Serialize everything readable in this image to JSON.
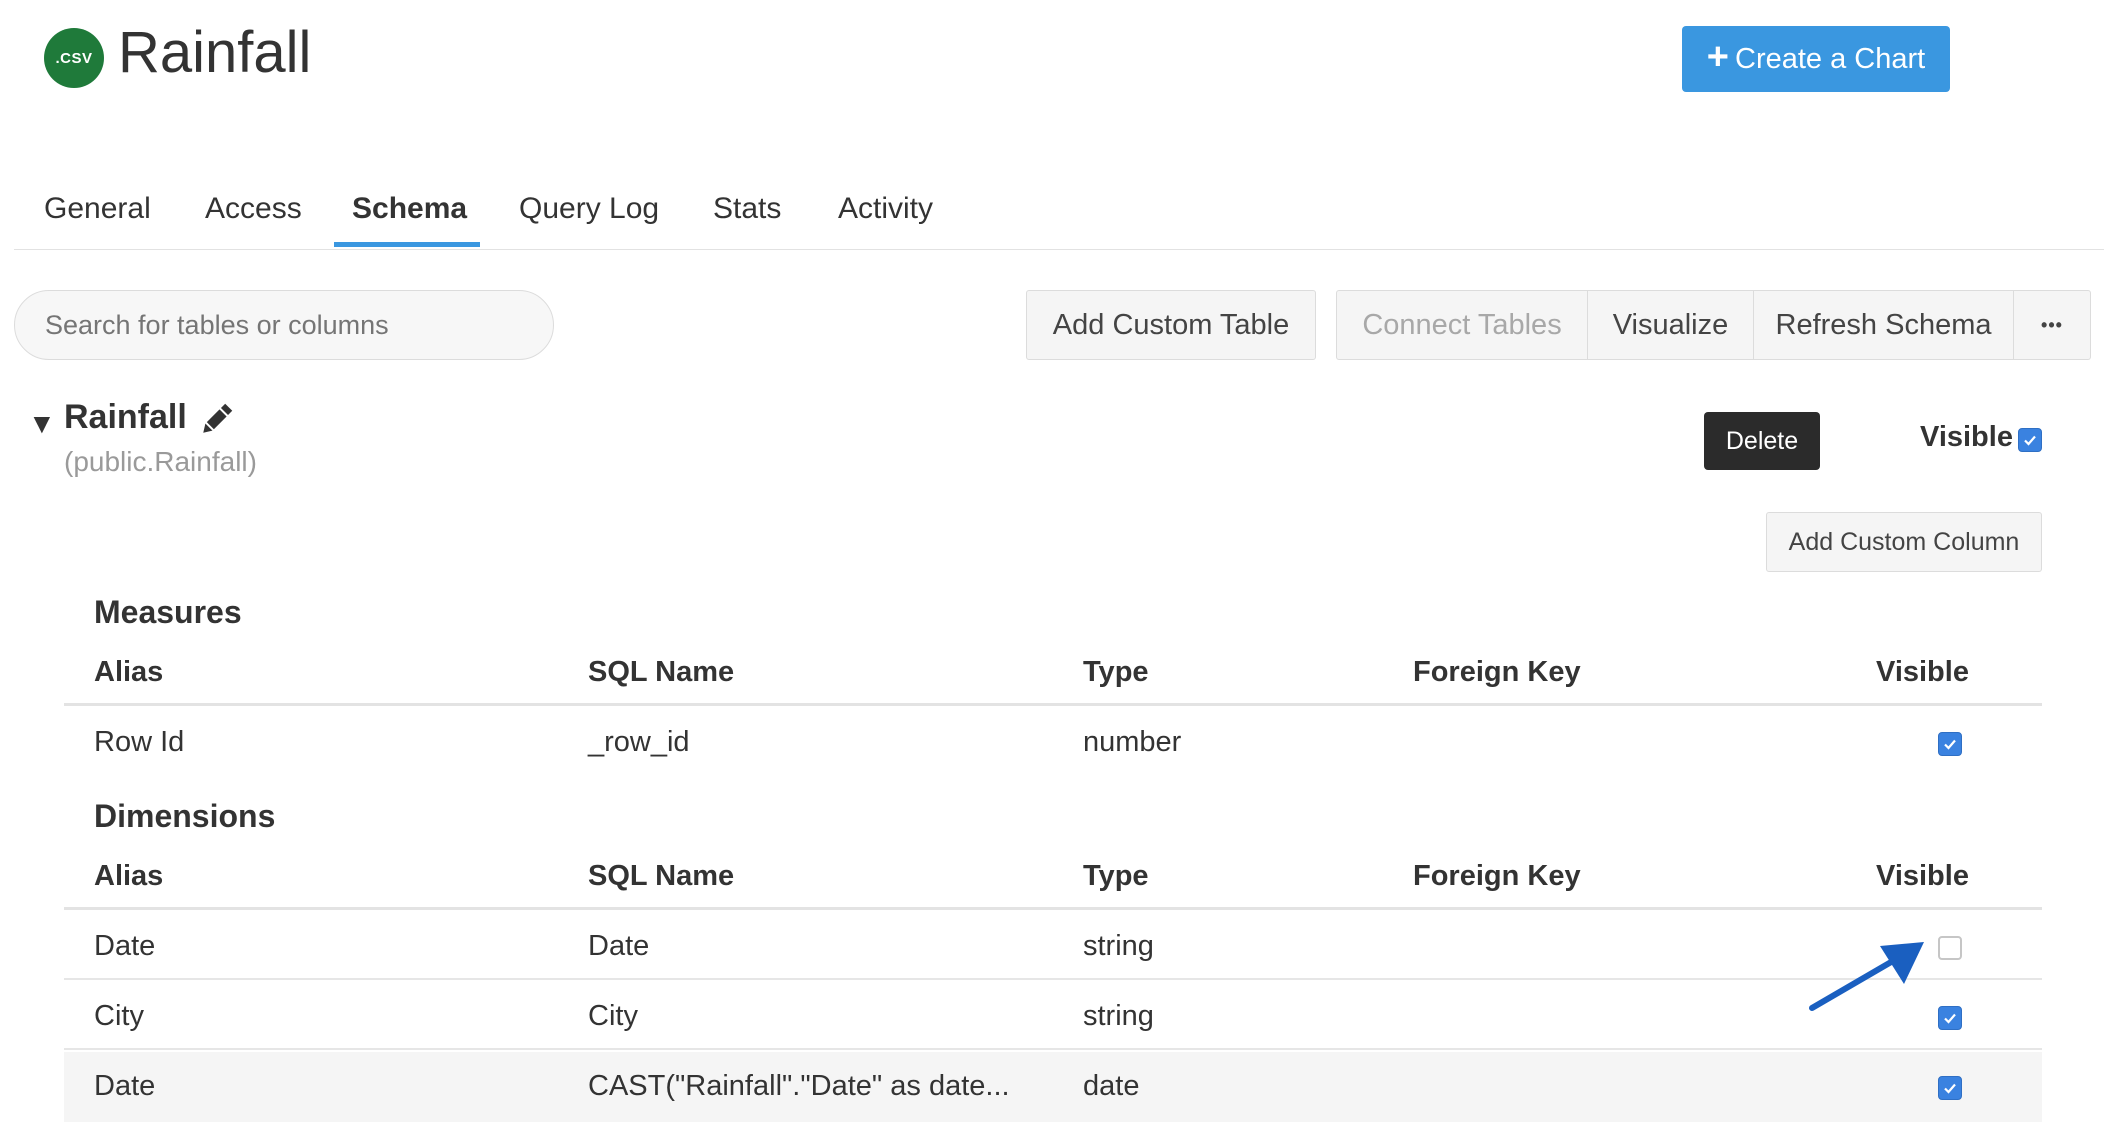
{
  "header": {
    "logo_text": ".CSV",
    "title": "Rainfall",
    "create_button": "Create a Chart"
  },
  "tabs": [
    {
      "label": "General",
      "active": false
    },
    {
      "label": "Access",
      "active": false
    },
    {
      "label": "Schema",
      "active": true
    },
    {
      "label": "Query Log",
      "active": false
    },
    {
      "label": "Stats",
      "active": false
    },
    {
      "label": "Activity",
      "active": false
    }
  ],
  "toolbar": {
    "search_placeholder": "Search for tables or columns",
    "add_custom_table": "Add Custom Table",
    "connect_tables": "Connect Tables",
    "visualize": "Visualize",
    "refresh_schema": "Refresh Schema",
    "more": "•••"
  },
  "table": {
    "name": "Rainfall",
    "qualified_name": "(public.Rainfall)",
    "delete_label": "Delete",
    "visible_label": "Visible",
    "visible": true,
    "add_custom_column": "Add Custom Column"
  },
  "columns": {
    "alias": "Alias",
    "sql_name": "SQL Name",
    "type": "Type",
    "foreign_key": "Foreign Key",
    "visible": "Visible"
  },
  "measures": {
    "title": "Measures",
    "rows": [
      {
        "alias": "Row Id",
        "sql_name": "_row_id",
        "type": "number",
        "foreign_key": "",
        "visible": true
      }
    ]
  },
  "dimensions": {
    "title": "Dimensions",
    "rows": [
      {
        "alias": "Date",
        "sql_name": "Date",
        "type": "string",
        "foreign_key": "",
        "visible": false
      },
      {
        "alias": "City",
        "sql_name": "City",
        "type": "string",
        "foreign_key": "",
        "visible": true
      },
      {
        "alias": "Date",
        "sql_name": "CAST(\"Rainfall\".\"Date\" as date...",
        "type": "date",
        "foreign_key": "",
        "visible": true
      }
    ]
  },
  "colors": {
    "accent": "#3a97e0",
    "checkbox": "#3a82e0",
    "logo": "#1f7a3a",
    "arrow": "#1a5fc0"
  }
}
